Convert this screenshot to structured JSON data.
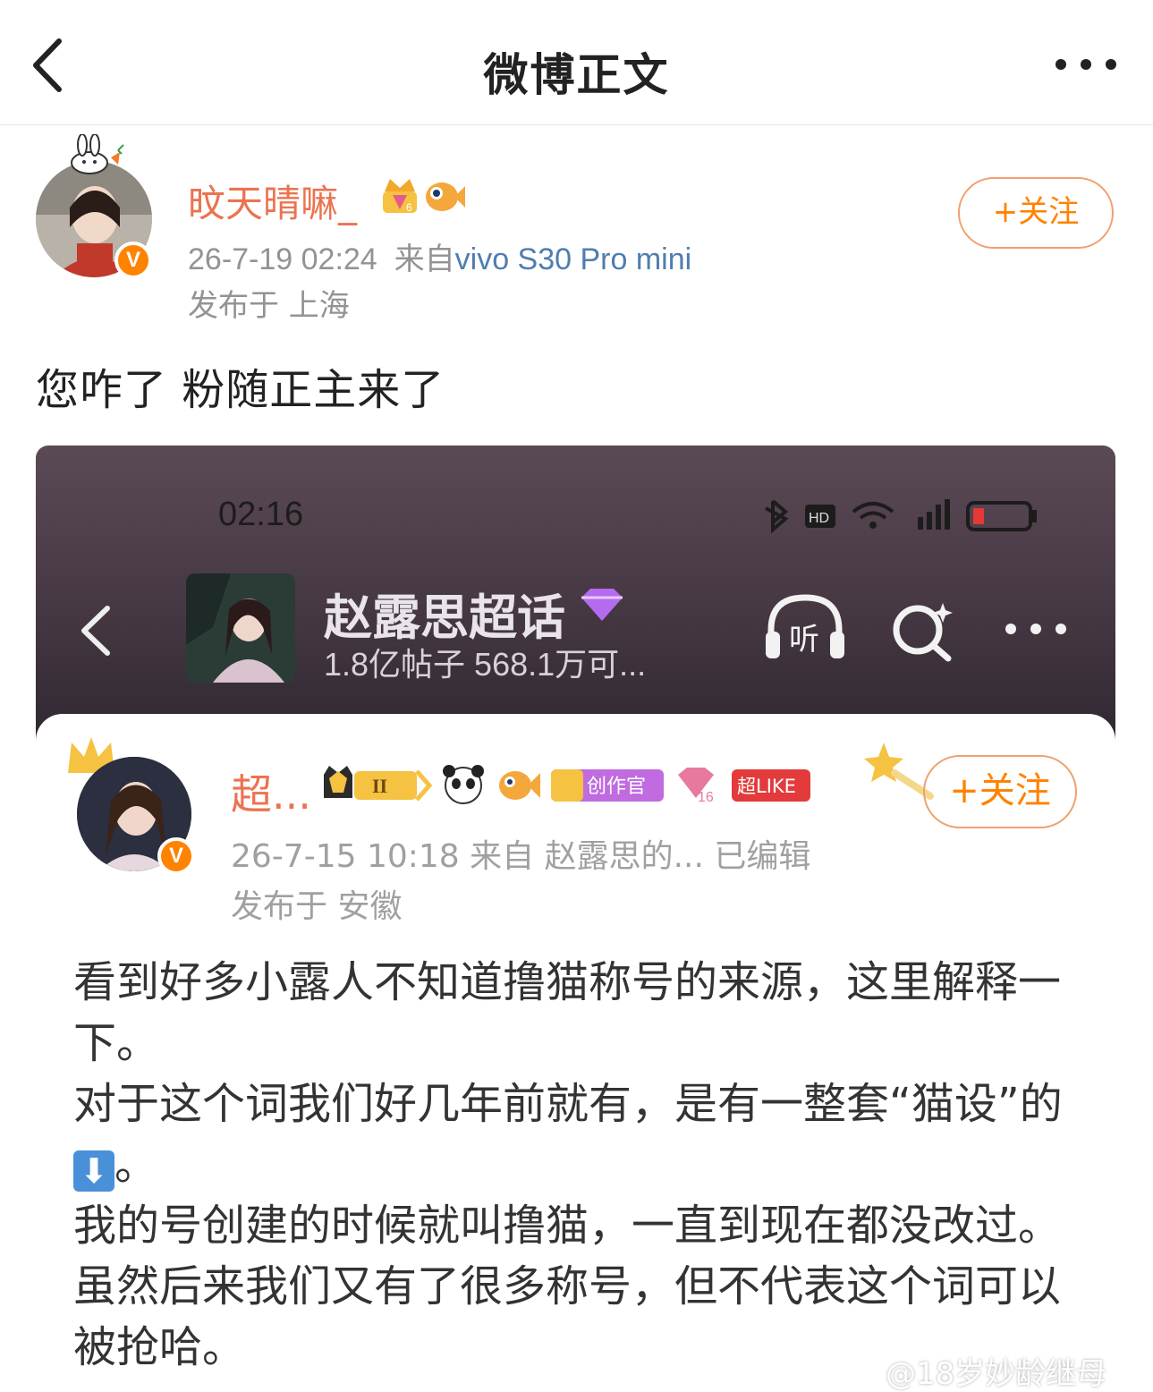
{
  "header": {
    "title": "微博正文",
    "back_icon": "chevron-left-icon",
    "more_icon": "more-dots-icon"
  },
  "post": {
    "author": {
      "name": "旼天晴嘛_",
      "avatar": "avatar-photo",
      "verified_badge": "V",
      "badges": [
        "crown-level-badge",
        "fish-badge"
      ]
    },
    "time": "26-7-19 02:24",
    "source_prefix": "来自",
    "source": "vivo S30 Pro mini",
    "location": "发布于 上海",
    "follow_label": "+关注",
    "text": "您咋了 粉随正主来了"
  },
  "screenshot": {
    "status_time": "02:16",
    "status_icons": [
      "bluetooth-icon",
      "hd-icon",
      "wifi-icon",
      "signal-icon",
      "battery-icon"
    ],
    "topic": {
      "title": "赵露思超话",
      "stats": "1.8亿帖子 568.1万可...",
      "listen_label": "听"
    },
    "card": {
      "author_name": "超...",
      "verified_badge": "V",
      "badges": [
        {
          "name": "crown-level-badge",
          "text": "II"
        },
        {
          "name": "panda-badge",
          "text": ""
        },
        {
          "name": "fish-badge",
          "text": ""
        },
        {
          "name": "creator-badge",
          "text": "创作官"
        },
        {
          "name": "diamond-badge",
          "text": "16"
        },
        {
          "name": "super-like-badge",
          "text": "超LIKE"
        }
      ],
      "follow_label": "+关注",
      "meta": "26-7-15 10:18  来自 赵露思的...  已编辑",
      "location": "发布于 安徽",
      "body": {
        "line1": "看到好多小露人不知道撸猫称号的来源，这里解释一下。",
        "line2_a": "对于这个词我们好几年前就有，是有一整套“猫设”的",
        "arrow": "⬇",
        "line2_b": "。",
        "line3": "我的号创建的时候就叫撸猫，一直到现在都没改过。虽然后来我们又有了很多称号，但不代表这个词可以被抢哈。"
      }
    }
  },
  "watermark": "@18岁妙龄继母",
  "colors": {
    "accent_orange": "#ff8200",
    "name_orange": "#eb7350",
    "link_blue": "#507daf",
    "meta_gray": "#939393"
  }
}
